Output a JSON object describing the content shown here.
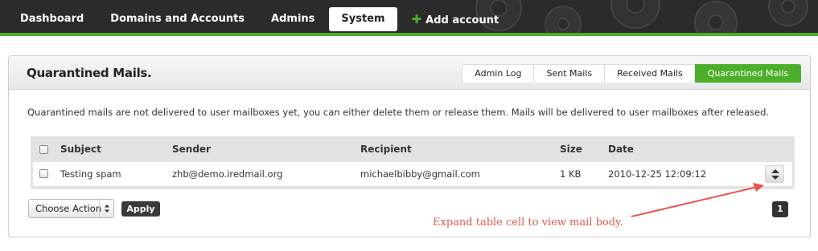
{
  "nav": {
    "items": [
      {
        "label": "Dashboard",
        "active": false
      },
      {
        "label": "Domains and Accounts",
        "active": false
      },
      {
        "label": "Admins",
        "active": false
      },
      {
        "label": "System",
        "active": true
      }
    ],
    "add_account_label": "Add account",
    "add_icon": "plus-icon"
  },
  "panel": {
    "title": "Quarantined Mails.",
    "tabs": [
      {
        "label": "Admin Log",
        "active": false
      },
      {
        "label": "Sent Mails",
        "active": false
      },
      {
        "label": "Received Mails",
        "active": false
      },
      {
        "label": "Quarantined Mails",
        "active": true
      }
    ],
    "description": "Quarantined mails are not delivered to user mailboxes yet, you can either delete them or release them. Mails will be delivered to user mailboxes after released."
  },
  "table": {
    "headers": {
      "subject": "Subject",
      "sender": "Sender",
      "recipient": "Recipient",
      "size": "Size",
      "date": "Date"
    },
    "rows": [
      {
        "subject": "Testing spam",
        "sender": "zhb@demo.iredmail.org",
        "recipient": "michaelbibby@gmail.com",
        "size": "1 KB",
        "date": "2010-12-25 12:09:12",
        "expand_icon": "expand-collapse-icon"
      }
    ]
  },
  "actions": {
    "select_value": "Choose Action",
    "apply_label": "Apply"
  },
  "pagination": {
    "current_page": "1"
  },
  "annotation": {
    "text": "Expand table cell to view mail body."
  },
  "colors": {
    "accent_green": "#4caf2a",
    "topbar": "#2b2b2b",
    "annotation_red": "#e8564a"
  }
}
